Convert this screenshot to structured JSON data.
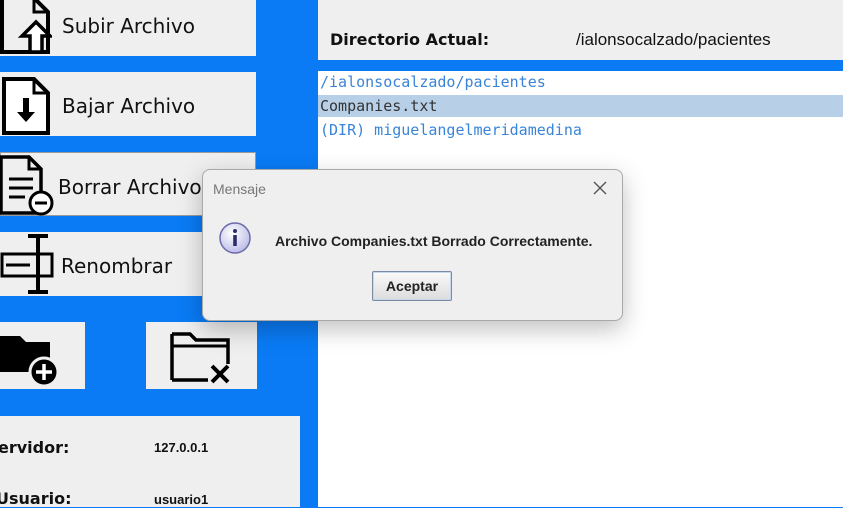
{
  "sidebar": {
    "upload_label": "Subir Archivo",
    "download_label": "Bajar Archivo",
    "delete_label": "Borrar Archivo",
    "rename_label": "Renombrar"
  },
  "icons": {
    "upload": "file-upload-icon",
    "download": "file-download-icon",
    "delete": "file-delete-icon",
    "rename": "rename-icon",
    "new_folder": "folder-add-icon",
    "delete_folder": "folder-delete-icon",
    "dialog_info": "info-icon",
    "dialog_close": "close-icon"
  },
  "connection": {
    "server_label": "ervidor:",
    "server_value": "127.0.0.1",
    "user_label": "Usuario:",
    "user_value": "usuario1"
  },
  "directory": {
    "label": "Directorio Actual:",
    "value": "/ialonsocalzado/pacientes"
  },
  "files": [
    {
      "name": "/ialonsocalzado/pacientes"
    },
    {
      "name": "Companies.txt"
    },
    {
      "name": "(DIR) miguelangelmeridamedina"
    }
  ],
  "dialog": {
    "title": "Mensaje",
    "message": "Archivo Companies.txt Borrado Correctamente.",
    "ok_label": "Aceptar"
  },
  "colors": {
    "background": "#0a7bf5",
    "panel": "#efefef",
    "selection": "#b8cfe8",
    "link_text": "#3a84d8"
  }
}
